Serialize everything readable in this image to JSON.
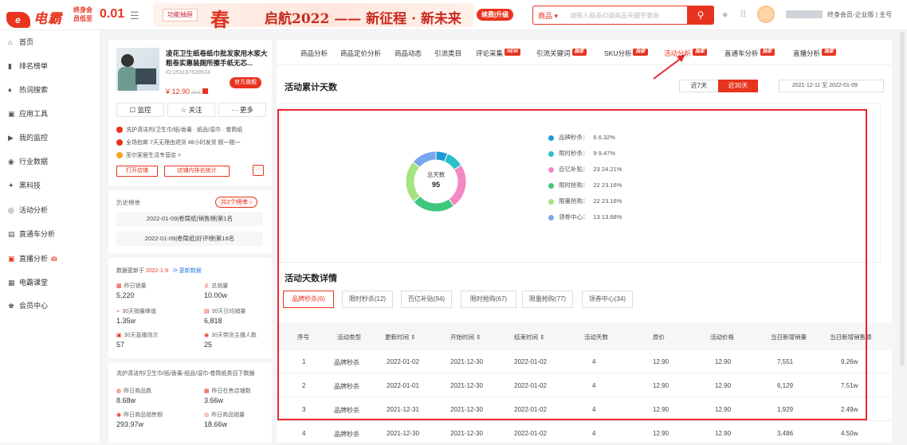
{
  "header": {
    "logo_mark": "e",
    "logo_text": "电霸",
    "promo_line1": "终身会",
    "promo_line2": "员低至",
    "promo_price": "0.01",
    "feature_label": "功能抽屉",
    "chun": "春",
    "slogan": "启航2022 —— 新征程 · 新未来",
    "vip_label": "续费|升级",
    "search_category": "商品 ▾",
    "search_placeholder": "请输入商品ID或商品关键字查询",
    "user_info": "终身会员-企业版 | 主号"
  },
  "sidebar": {
    "items": [
      {
        "icon": "⌂",
        "icon_name": "home-icon",
        "label": "首页"
      },
      {
        "icon": "▮",
        "icon_name": "rank-chart-icon",
        "label": "排名榜单"
      },
      {
        "icon": "♦",
        "icon_name": "hot-search-icon",
        "label": "热词搜索"
      },
      {
        "icon": "▣",
        "icon_name": "tools-icon",
        "label": "应用工具"
      },
      {
        "icon": "▶",
        "icon_name": "monitor-icon",
        "label": "我的监控"
      },
      {
        "icon": "◉",
        "icon_name": "industry-icon",
        "label": "行业数据"
      },
      {
        "icon": "✦",
        "icon_name": "black-tech-icon",
        "label": "黑科技"
      },
      {
        "icon": "◎",
        "icon_name": "activity-icon",
        "label": "活动分析"
      },
      {
        "icon": "▤",
        "icon_name": "train-icon",
        "label": "直通车分析"
      },
      {
        "icon": "▣",
        "icon_name": "live-icon",
        "label": "直播分析"
      },
      {
        "icon": "▦",
        "icon_name": "course-icon",
        "label": "电霸课堂"
      },
      {
        "icon": "♚",
        "icon_name": "member-icon",
        "label": "会员中心"
      }
    ]
  },
  "product": {
    "title": "凌花卫生纸卷纸巾批发家用木浆大粗卷实惠装厕所擦手纸无芯...",
    "id": "ID:253197639524",
    "price": "¥ 12.90",
    "old_price": "39.9",
    "flag_label": "官方旗舰",
    "monitor_label": "☐ 监控",
    "follow_label": "☆ 关注",
    "more_label": "··· 更多",
    "category": "洗护清洁剂/卫生巾/纸/香薰 · 纸品/湿巾 · 卷筒纸",
    "service": "全场包邮   7天无理由退货   48小时发货   假一赔一",
    "shop": "圣尔家居生活专营店 >",
    "shop_btn1": "打开店铺",
    "shop_btn2": "店铺内排名统计",
    "more_dots": "···"
  },
  "history": {
    "label": "历史榜单",
    "rank_btn": "共2个榜单 ›",
    "entries": [
      "2022-01-09|卷筒纸|销售榜|第1名",
      "2022-01-09|卷筒纸|好评榜|第18名"
    ]
  },
  "stats": {
    "update_prefix": "数据更新于",
    "update_date": "2022-1-9",
    "update_link": "更新数据",
    "items": [
      {
        "label": "昨日销量",
        "value": "5,220"
      },
      {
        "label": "总销量",
        "value": "10.00w"
      },
      {
        "label": "30天销量峰值",
        "value": "1.35w"
      },
      {
        "label": "30天日均销量",
        "value": "6,818"
      },
      {
        "label": "30天直播场次",
        "value": "57"
      },
      {
        "label": "30天带货主播人数",
        "value": "25"
      }
    ],
    "category_path": "洗护清洁剂/卫生巾/纸/香薰-纸品/湿巾-卷筒纸类目下数据",
    "items2": [
      {
        "label": "昨日商品数",
        "value": "8.68w"
      },
      {
        "label": "昨日在售店铺数",
        "value": "3.66w"
      },
      {
        "label": "昨日商品销售额",
        "value": "293.97w"
      },
      {
        "label": "昨日商品销量",
        "value": "18.66w"
      }
    ]
  },
  "tabs": [
    {
      "label": "商品分析",
      "badge": ""
    },
    {
      "label": "商品定价分析",
      "badge": ""
    },
    {
      "label": "商品动态",
      "badge": ""
    },
    {
      "label": "引流类目",
      "badge": ""
    },
    {
      "label": "评论采集",
      "badge": "NEW"
    },
    {
      "label": "引流关键词",
      "badge": "独家"
    },
    {
      "label": "SKU分析",
      "badge": "独家"
    },
    {
      "label": "活动分析",
      "badge": "独家"
    },
    {
      "label": "直通车分析",
      "badge": "独家"
    },
    {
      "label": "直播分析",
      "badge": "独家"
    }
  ],
  "summary": {
    "title": "活动累计天数",
    "seg1": "近7天",
    "seg2": "近30天",
    "date_start": "2021-12-11",
    "date_sep": "至",
    "date_end": "2022-01-09",
    "center_label": "总天数",
    "center_value": "95"
  },
  "chart_data": {
    "type": "pie",
    "title": "活动累计天数",
    "total": 95,
    "slices": [
      {
        "name": "品牌秒杀",
        "value": 6,
        "percent": "6.32%",
        "color": "#1f9ad6"
      },
      {
        "name": "限时秒杀",
        "value": 9,
        "percent": "9.47%",
        "color": "#27c1c8"
      },
      {
        "name": "百亿补贴",
        "value": 23,
        "percent": "24.21%",
        "color": "#f28ac2"
      },
      {
        "name": "限时抢购",
        "value": 22,
        "percent": "23.16%",
        "color": "#3ec77e"
      },
      {
        "name": "限量抢购",
        "value": 22,
        "percent": "23.16%",
        "color": "#a5e37f"
      },
      {
        "name": "领券中心",
        "value": 13,
        "percent": "13.68%",
        "color": "#7aa5ef"
      }
    ]
  },
  "detail": {
    "title": "活动天数详情",
    "tabs": [
      "品牌秒杀(6)",
      "限时秒杀(12)",
      "百亿补贴(94)",
      "限时抢购(67)",
      "限量抢购(77)",
      "领券中心(34)"
    ],
    "columns": [
      "序号",
      "活动类型",
      "更新时间 ⇕",
      "开始时间 ⇕",
      "结束时间 ⇕",
      "活动天数",
      "原价",
      "活动价格",
      "当日新增销量",
      "当日新增销售额"
    ],
    "rows": [
      [
        "1",
        "品牌秒杀",
        "2022-01-02",
        "2021-12-30",
        "2022-01-02",
        "4",
        "12.90",
        "12.90",
        "7,551",
        "9.26w"
      ],
      [
        "2",
        "品牌秒杀",
        "2022-01-01",
        "2021-12-30",
        "2022-01-02",
        "4",
        "12.90",
        "12.90",
        "6,129",
        "7.51w"
      ],
      [
        "3",
        "品牌秒杀",
        "2021-12-31",
        "2021-12-30",
        "2022-01-02",
        "4",
        "12.90",
        "12.90",
        "1,929",
        "2.49w"
      ],
      [
        "4",
        "品牌秒杀",
        "2021-12-30",
        "2021-12-30",
        "2022-01-02",
        "4",
        "12.90",
        "12.90",
        "3,486",
        "4.50w"
      ]
    ]
  }
}
